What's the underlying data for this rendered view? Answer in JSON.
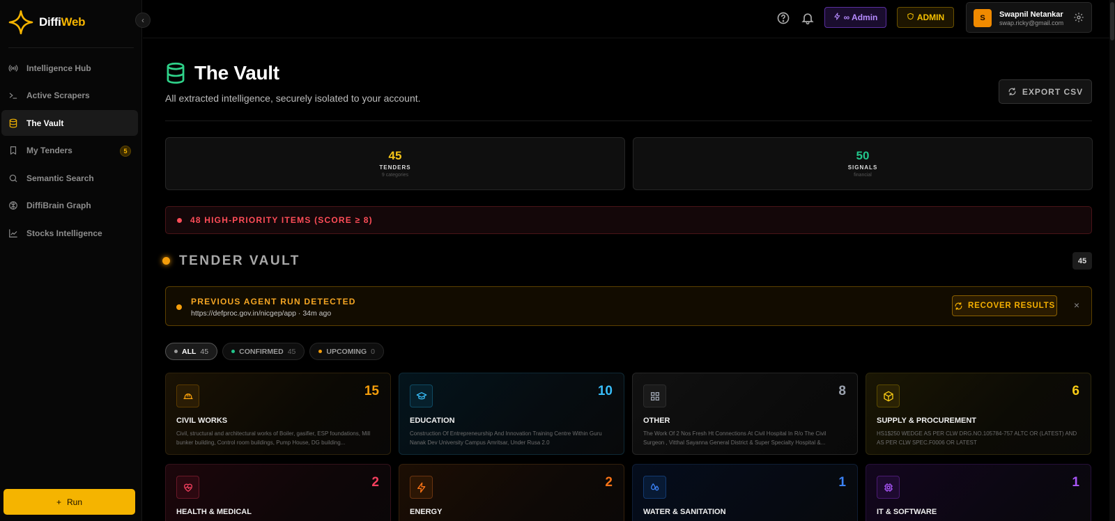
{
  "app": {
    "logo_main": "Diffi",
    "logo_accent": "Web"
  },
  "sidebar": {
    "items": [
      {
        "label": "Intelligence Hub",
        "icon": "broadcast-icon",
        "active": false
      },
      {
        "label": "Active Scrapers",
        "icon": "terminal-icon",
        "active": false
      },
      {
        "label": "The Vault",
        "icon": "database-icon",
        "active": true
      },
      {
        "label": "My Tenders",
        "icon": "bookmark-icon",
        "active": false,
        "badge": "5"
      },
      {
        "label": "Semantic Search",
        "icon": "search-icon",
        "active": false
      },
      {
        "label": "DiffiBrain Graph",
        "icon": "brain-icon",
        "active": false
      },
      {
        "label": "Stocks Intelligence",
        "icon": "chart-line-icon",
        "active": false
      }
    ],
    "run_label": "Run"
  },
  "topbar": {
    "admin_pill": "∞ Admin",
    "admin_badge": "ADMIN",
    "user_initial": "S",
    "user_name": "Swapnil Netankar",
    "user_email": "swap.ricky@gmail.com"
  },
  "page": {
    "title": "The Vault",
    "subtitle": "All extracted intelligence, securely isolated to your account.",
    "export_label": "EXPORT CSV"
  },
  "stats": [
    {
      "value": "45",
      "label": "TENDERS",
      "sub": "9 categories",
      "color": "#f5c518"
    },
    {
      "value": "50",
      "label": "SIGNALS",
      "sub": "financial",
      "color": "#22c58b"
    }
  ],
  "priority_banner": "48 HIGH-PRIORITY ITEMS (SCORE ≥ 8)",
  "section": {
    "title": "TENDER VAULT",
    "count": "45"
  },
  "agent_banner": {
    "title": "PREVIOUS AGENT RUN DETECTED",
    "url": "https://defproc.gov.in/nicgep/app · 34m ago",
    "recover_label": "RECOVER RESULTS",
    "close": "×"
  },
  "filters": [
    {
      "label": "ALL",
      "count": "45",
      "dot": "#9a9a9a",
      "active": true
    },
    {
      "label": "CONFIRMED",
      "count": "45",
      "dot": "#22c58b",
      "active": false
    },
    {
      "label": "UPCOMING",
      "count": "0",
      "dot": "#f59e0b",
      "active": false
    }
  ],
  "categories": [
    {
      "title": "CIVIL WORKS",
      "count": "15",
      "color": "#f59e0b",
      "icon": "hard-hat-icon",
      "desc": "Civil, structural and architectural works of Boiler, gasifier, ESP foundations, Mill bunker building, Control room buildings, Pump House, DG building..."
    },
    {
      "title": "EDUCATION",
      "count": "10",
      "color": "#38bdf8",
      "icon": "graduation-cap-icon",
      "desc": "Construction Of Entrepreneurship And Innovation Training Centre Within Guru Nanak Dev University Campus Amritsar, Under Rusa 2.0"
    },
    {
      "title": "OTHER",
      "count": "8",
      "color": "#9ca3af",
      "icon": "grid-icon",
      "desc": "The Work Of 2 Nos Fresh Ht Connections At Civil Hospital In R/o The Civil Surgeon , Vitthal Sayanna General District & Super Specialty Hospital &..."
    },
    {
      "title": "SUPPLY & PROCUREMENT",
      "count": "6",
      "color": "#facc15",
      "icon": "package-icon",
      "desc": "HS1$250 WEDGE AS PER CLW DRG.NO.105784-757 ALTC OR (LATEST) AND AS PER CLW SPEC.F0006 OR LATEST"
    },
    {
      "title": "HEALTH & MEDICAL",
      "count": "2",
      "color": "#f43f5e",
      "icon": "heart-pulse-icon",
      "desc": ""
    },
    {
      "title": "ENERGY",
      "count": "2",
      "color": "#f97316",
      "icon": "lightning-icon",
      "desc": ""
    },
    {
      "title": "WATER & SANITATION",
      "count": "1",
      "color": "#3b82f6",
      "icon": "droplets-icon",
      "desc": ""
    },
    {
      "title": "IT & SOFTWARE",
      "count": "1",
      "color": "#a855f7",
      "icon": "cpu-icon",
      "desc": ""
    }
  ]
}
